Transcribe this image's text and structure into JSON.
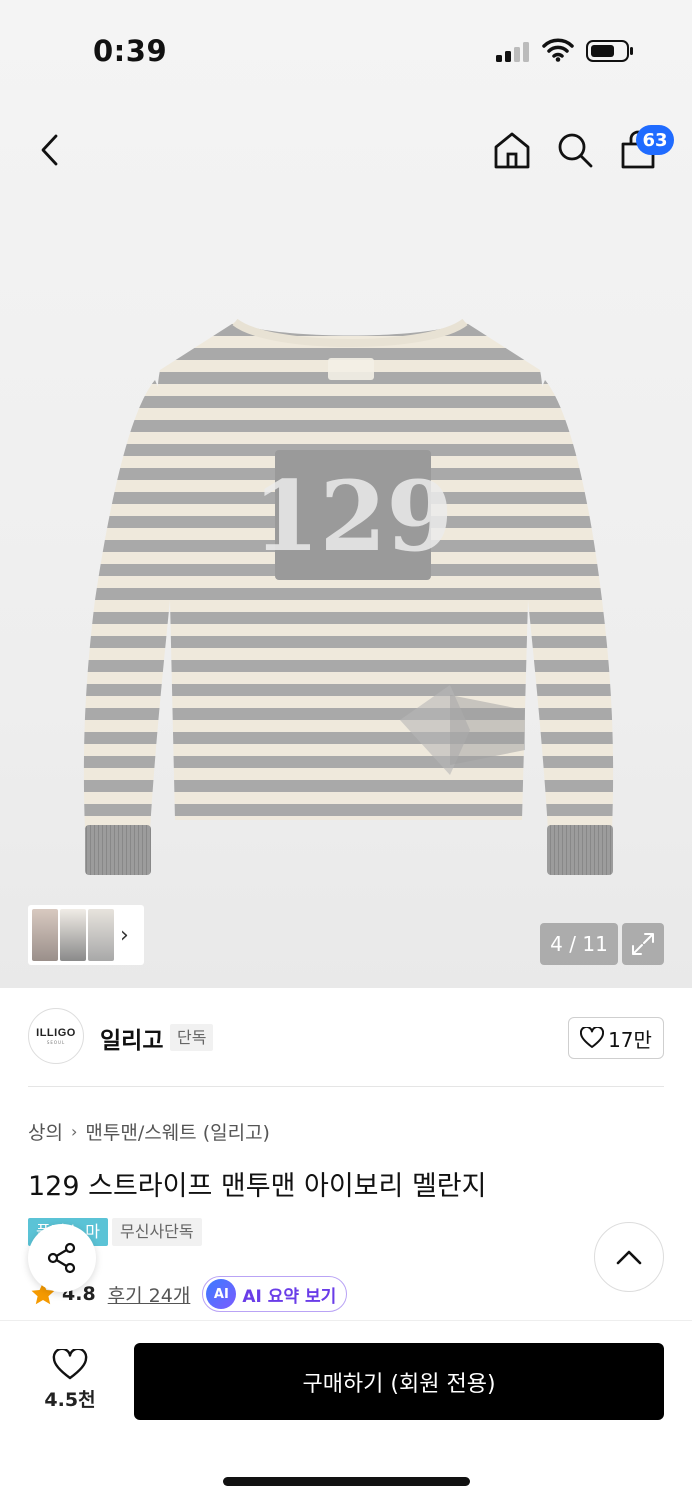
{
  "status_bar": {
    "time": "0:39"
  },
  "nav": {
    "cart_count": "63"
  },
  "gallery": {
    "counter": "4 / 11"
  },
  "brand": {
    "logo_text": "ILLIGO",
    "logo_subtext": "SEOUL",
    "name": "일리고",
    "tag": "단독",
    "likes": "17만"
  },
  "breadcrumb": {
    "level1": "상의",
    "level2": "맨투맨/스웨트 (일리고)"
  },
  "product": {
    "title": "129 스트라이프 맨투맨 아이보리 멜란지",
    "badges": [
      "플러스 마크",
      "무신사단독"
    ],
    "rating": "4.8",
    "review_link": "후기 24개",
    "ai_label": "AI 요약 보기",
    "ai_icon_text": "AI"
  },
  "bottom": {
    "wish_count": "4.5천",
    "buy_label": "구매하기 (회원 전용)"
  },
  "colors": {
    "accent_blue": "#1f6bff",
    "badge_teal": "#5bc3d6",
    "star": "#f59a00",
    "ai_purple": "#6a3de8"
  }
}
